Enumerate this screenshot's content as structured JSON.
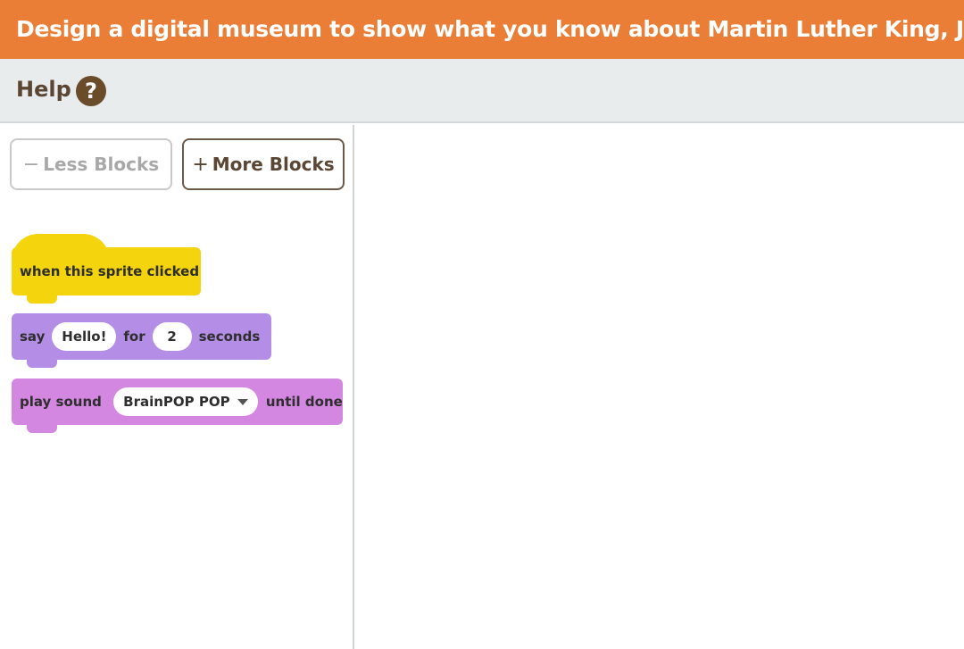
{
  "banner": {
    "title": "Design a digital museum to show what you know about Martin Luther King, Jr."
  },
  "help": {
    "label": "Help",
    "icon": "question-icon",
    "icon_glyph": "?"
  },
  "palette": {
    "less_button": {
      "symbol": "−",
      "label": "Less Blocks"
    },
    "more_button": {
      "symbol": "+",
      "label": "More Blocks"
    },
    "blocks": {
      "hat": {
        "label": "when this sprite clicked"
      },
      "say": {
        "prefix": "say",
        "message": "Hello!",
        "middle": "for",
        "seconds": "2",
        "suffix": "seconds"
      },
      "play": {
        "prefix": "play sound",
        "sound": "BrainPOP POP",
        "suffix": "until done"
      }
    }
  },
  "colors": {
    "banner": "#ea7e36",
    "events_block": "#f4d40d",
    "looks_block": "#b48de6",
    "sound_block": "#d487e0"
  }
}
